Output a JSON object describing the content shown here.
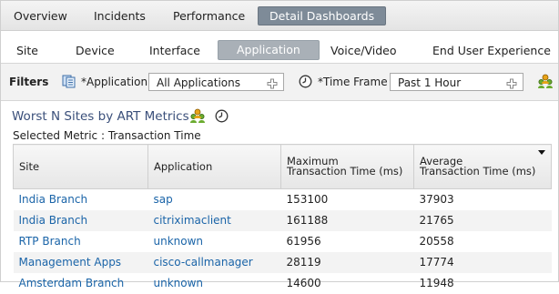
{
  "top_tabs": [
    {
      "label": "Overview",
      "active": false
    },
    {
      "label": "Incidents",
      "active": false
    },
    {
      "label": "Performance",
      "active": false
    },
    {
      "label": "Detail Dashboards",
      "active": true
    }
  ],
  "sub_tabs": [
    {
      "label": "Site",
      "active": false
    },
    {
      "label": "Device",
      "active": false
    },
    {
      "label": "Interface",
      "active": false
    },
    {
      "label": "Application",
      "active": true
    },
    {
      "label": "Voice/Video",
      "active": false
    },
    {
      "label": "End User Experience",
      "active": false
    }
  ],
  "filters": {
    "label": "Filters",
    "application_label": "*Application",
    "application_value": "All Applications",
    "time_frame_label": "*Time Frame",
    "time_frame_value": "Past 1 Hour"
  },
  "panel": {
    "title": "Worst N Sites by ART Metrics",
    "selected_metric": "Selected Metric : Transaction Time",
    "columns": [
      {
        "label": "Site"
      },
      {
        "label": "Application"
      },
      {
        "label": "Maximum\nTransaction Time (ms)"
      },
      {
        "label": "Average\nTransaction Time (ms)",
        "sorted": "desc"
      }
    ],
    "rows": [
      {
        "site": "India Branch",
        "application": "sap",
        "max": "153100",
        "avg": "37903"
      },
      {
        "site": "India Branch",
        "application": "citriximaclient",
        "max": "161188",
        "avg": "21765"
      },
      {
        "site": "RTP Branch",
        "application": "unknown",
        "max": "61956",
        "avg": "20558"
      },
      {
        "site": "Management Apps",
        "application": "cisco-callmanager",
        "max": "28119",
        "avg": "17774"
      },
      {
        "site": "Amsterdam Branch",
        "application": "unknown",
        "max": "14600",
        "avg": "11948"
      }
    ]
  },
  "icons": {
    "application_filter": "application-list-icon",
    "time_frame": "clock-icon",
    "people": "people-icon",
    "add": "plus-icon"
  },
  "colors": {
    "active_top_tab": "#7e8b98",
    "active_sub_tab": "#a9b0b7",
    "link": "#1a64a8",
    "panel_title": "#3a4f7a"
  }
}
